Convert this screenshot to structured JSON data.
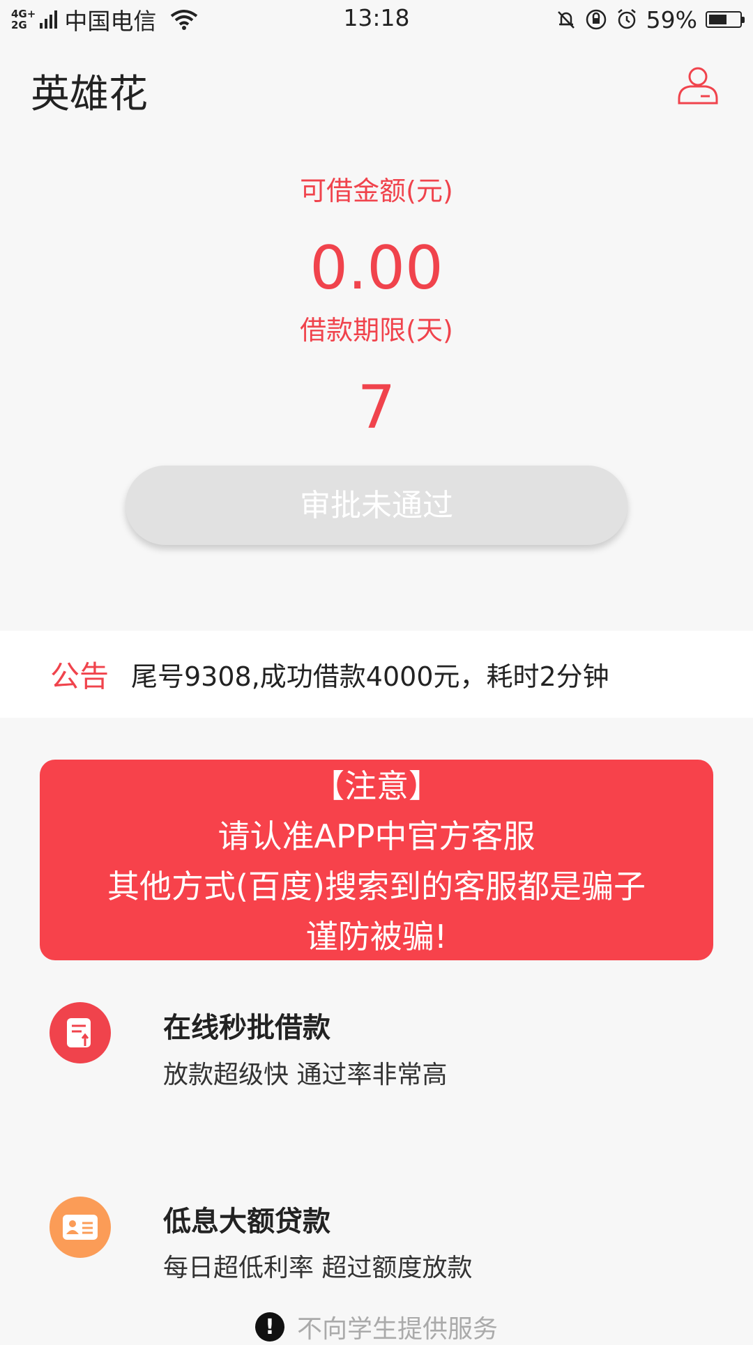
{
  "status_bar": {
    "network_top": "4G+",
    "network_bottom": "2G",
    "carrier": "中国电信",
    "time": "13:18",
    "battery": "59%"
  },
  "header": {
    "title": "英雄花",
    "profile_icon": "user-icon"
  },
  "loan": {
    "amount_label": "可借金额(元)",
    "amount": "0.00",
    "term_label": "借款期限(天)",
    "term": "7",
    "status_button": "审批未通过"
  },
  "announcement": {
    "label": "公告",
    "text": "尾号9308,成功借款4000元，耗时2分钟"
  },
  "warning": {
    "line1": "【注意】",
    "line2": "请认准APP中官方客服",
    "line3": "其他方式(百度)搜索到的客服都是骗子",
    "line4": "谨防被骗!"
  },
  "features": [
    {
      "icon": "document-icon",
      "title": "在线秒批借款",
      "desc": "放款超级快  通过率非常高"
    },
    {
      "icon": "id-card-icon",
      "title": "低息大额贷款",
      "desc": "每日超低利率   超过额度放款"
    }
  ],
  "footer": {
    "icon": "info-icon",
    "text": "不向学生提供服务"
  },
  "colors": {
    "accent": "#f0434c",
    "warning_bg": "#f7424b",
    "feature2": "#fb9c57",
    "button_disabled": "#e1e1e1"
  }
}
